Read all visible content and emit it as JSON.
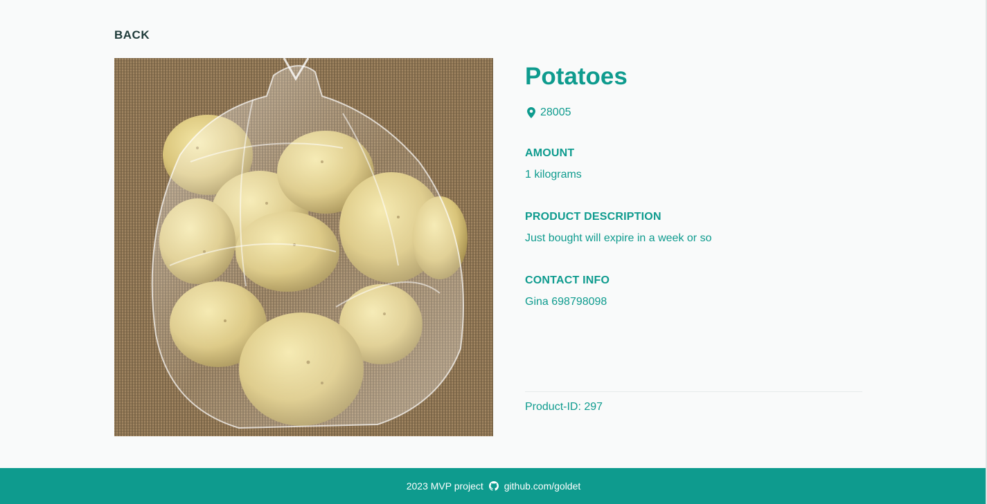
{
  "nav": {
    "back_label": "BACK"
  },
  "product": {
    "title": "Potatoes",
    "location_icon": "map-pin-icon",
    "postcode": "28005",
    "amount_label": "AMOUNT",
    "amount_value": "1 kilograms",
    "description_label": "PRODUCT DESCRIPTION",
    "description_value": "Just bought will expire in a week or so",
    "contact_label": "CONTACT INFO",
    "contact_value": "Gina 698798098",
    "id_text": "Product-ID: 297"
  },
  "footer": {
    "year_text": "2023 MVP project",
    "github_icon": "github-icon",
    "github_link": "github.com/goldet"
  },
  "colors": {
    "accent": "#0e9b8e",
    "heading_dark": "#1f3b3a",
    "background": "#f9fafa"
  }
}
